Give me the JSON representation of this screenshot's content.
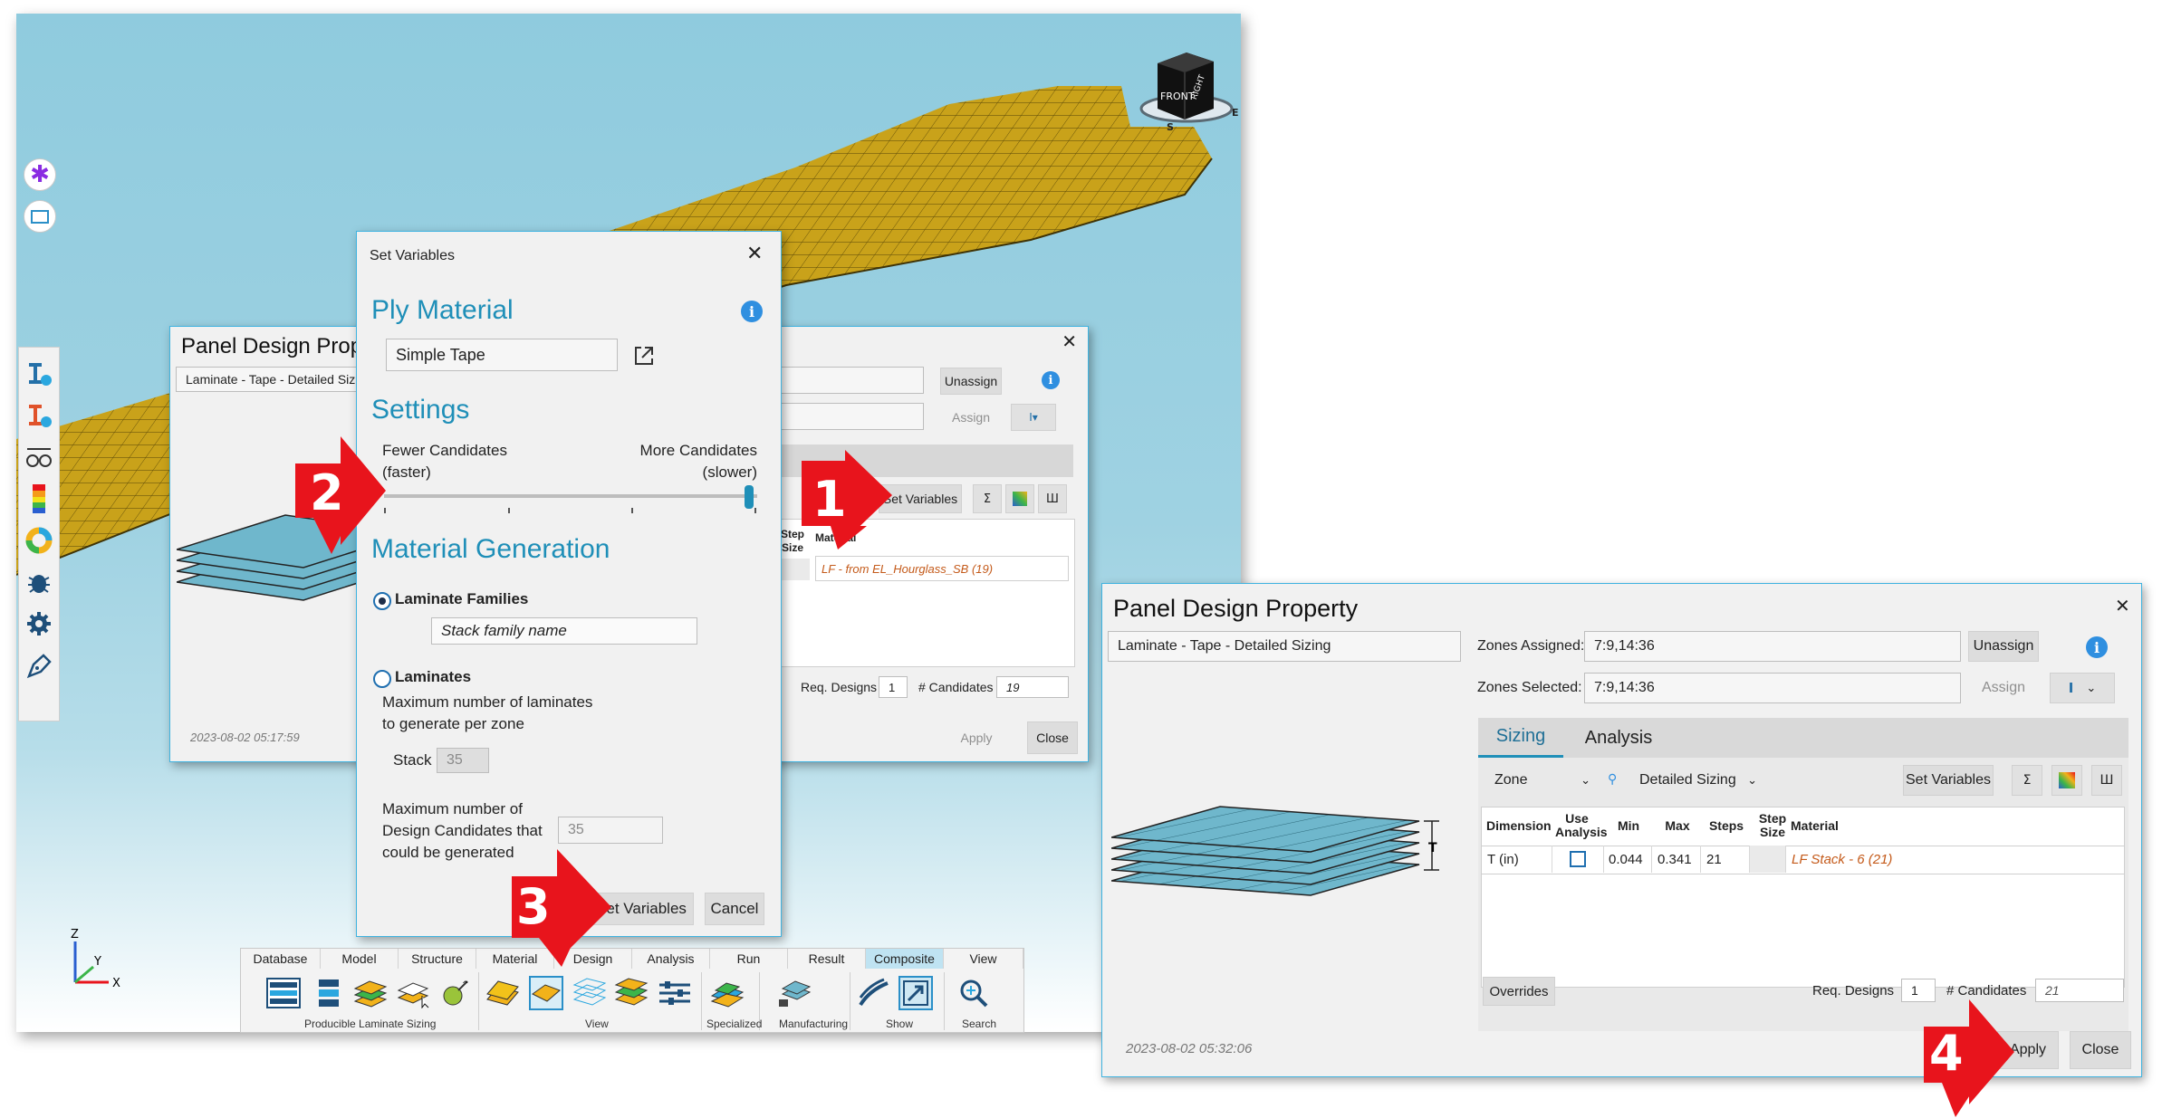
{
  "colors": {
    "accent": "#1f8fb8",
    "highlight_border": "#3fb3e0",
    "callout_red": "#e8141c",
    "material_orange": "#c45a1a",
    "info_blue": "#2f8fe0"
  },
  "viewcube": {
    "front": "FRONT",
    "right": "RIGHT",
    "s": "S",
    "e": "E"
  },
  "axes": {
    "z": "Z",
    "y": "Y",
    "x": "X"
  },
  "background_panel": {
    "title": "Panel Design Prope",
    "property_field": "Laminate - Tape - Detailed Sizin",
    "unassign": "Unassign",
    "assign": "Assign",
    "set_variables": "Set Variables",
    "col_step_size": "Step Size",
    "col_material": "Material",
    "material_value": "LF - from EL_Hourglass_SB (19)",
    "req_designs_label": "Req. Designs",
    "req_designs_value": "1",
    "candidates_label": "# Candidates",
    "candidates_value": "19",
    "timestamp": "2023-08-02 05:17:59",
    "apply": "Apply",
    "close": "Close"
  },
  "set_variables_dialog": {
    "title": "Set Variables",
    "ply_material_heading": "Ply Material",
    "ply_material_value": "Simple Tape",
    "settings_heading": "Settings",
    "fewer_candidates": "Fewer Candidates",
    "faster": "(faster)",
    "more_candidates": "More Candidates",
    "slower": "(slower)",
    "slider_level": 1.0,
    "material_generation_heading": "Material Generation",
    "laminate_families_label": "Laminate Families",
    "laminate_families_selected": true,
    "family_name_placeholder": "Stack family name",
    "laminates_label": "Laminates",
    "max_laminates_text_1": "Maximum number of laminates",
    "max_laminates_text_2": "to generate per zone",
    "stack_label": "Stack",
    "stack_value": "35",
    "max_candidates_text_1": "Maximum number of",
    "max_candidates_text_2": "Design Candidates that",
    "max_candidates_text_3": "could be generated",
    "max_candidates_value": "35",
    "set_variables_button": "Set Variables",
    "cancel_button": "Cancel"
  },
  "panel_design_property": {
    "title": "Panel Design Property",
    "property_field": "Laminate - Tape - Detailed Sizing",
    "zones_assigned_label": "Zones Assigned:",
    "zones_assigned_value": "7:9,14:36",
    "zones_selected_label": "Zones Selected:",
    "zones_selected_value": "7:9,14:36",
    "unassign": "Unassign",
    "assign": "Assign",
    "tabs": [
      "Sizing",
      "Analysis"
    ],
    "zone_select": "Zone",
    "sizing_select": "Detailed Sizing",
    "set_variables": "Set Variables",
    "thickness_label": "T",
    "columns": [
      "Dimension",
      "Use Analysis",
      "Min",
      "Max",
      "Steps",
      "Step Size",
      "Material"
    ],
    "row": {
      "dimension": "T (in)",
      "use_analysis": false,
      "min": "0.044",
      "max": "0.341",
      "steps": "21",
      "step_size": "",
      "material": "LF Stack - 6 (21)"
    },
    "overrides": "Overrides",
    "req_designs_label": "Req. Designs",
    "req_designs_value": "1",
    "candidates_label": "# Candidates",
    "candidates_value": "21",
    "timestamp": "2023-08-02 05:32:06",
    "apply": "Apply",
    "close": "Close"
  },
  "ribbon": {
    "tabs": [
      "Database",
      "Model",
      "Structure",
      "Material",
      "Design",
      "Analysis",
      "Run",
      "Result",
      "Composite",
      "View"
    ],
    "active_tab": "Composite",
    "groups": [
      "Producible Laminate Sizing",
      "View",
      "Specialized",
      "Manufacturing",
      "Show",
      "Search"
    ]
  },
  "callouts": [
    "1",
    "2",
    "3",
    "4"
  ]
}
